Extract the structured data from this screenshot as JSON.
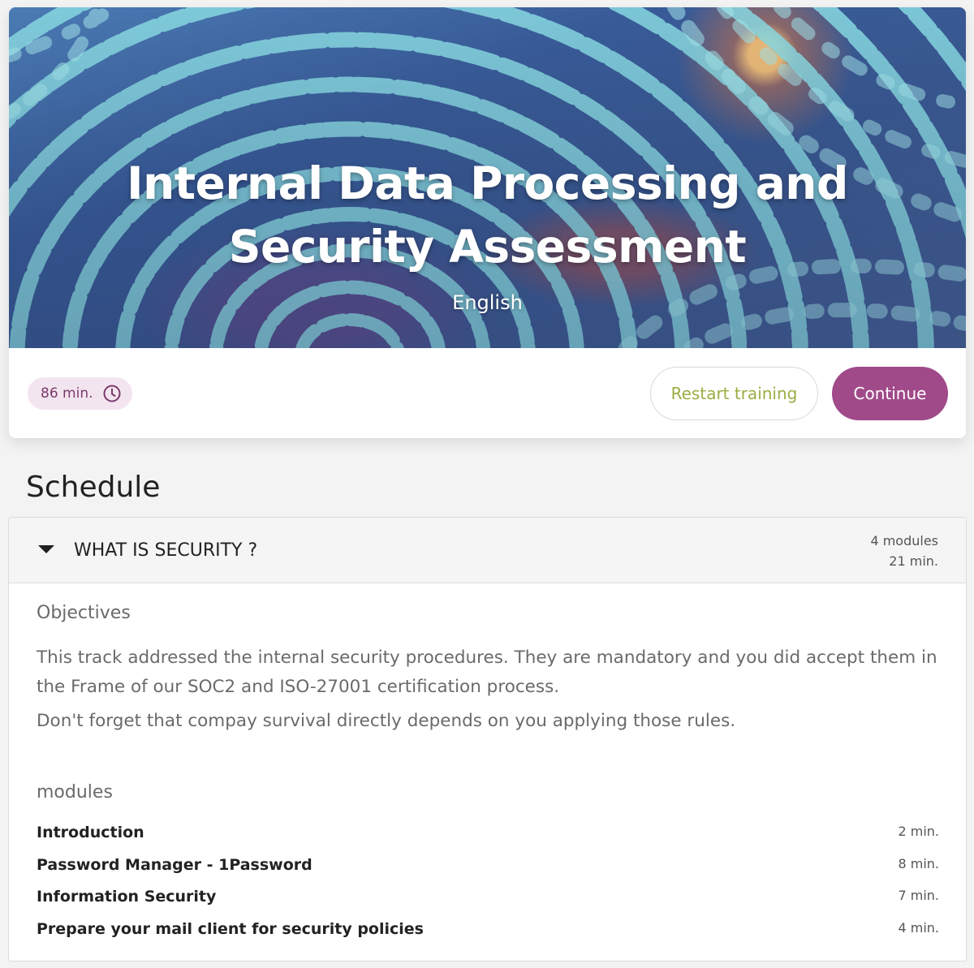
{
  "hero": {
    "title": "Internal Data Processing and Security Assessment",
    "language": "English",
    "duration": "86 min.",
    "duration_icon": "clock-icon",
    "accent_color": "#a04a8a"
  },
  "actions": {
    "restart_label": "Restart training",
    "continue_label": "Continue"
  },
  "schedule": {
    "heading": "Schedule",
    "sections": [
      {
        "title": "WHAT IS SECURITY ?",
        "modules_count": "4 modules",
        "duration": "21 min.",
        "expanded": true,
        "objectives_label": "Objectives",
        "objectives_paragraphs": [
          "This track addressed the internal security procedures. They are mandatory and you did accept them in the Frame of our SOC2 and ISO-27001 certification process.",
          "Don't forget that compay survival directly depends on you applying those rules."
        ],
        "modules_label": "modules",
        "modules": [
          {
            "name": "Introduction",
            "duration": "2 min."
          },
          {
            "name": "Password Manager - 1Password",
            "duration": "8 min."
          },
          {
            "name": "Information Security",
            "duration": "7 min."
          },
          {
            "name": "Prepare your mail client for security policies",
            "duration": "4 min."
          }
        ]
      }
    ]
  }
}
